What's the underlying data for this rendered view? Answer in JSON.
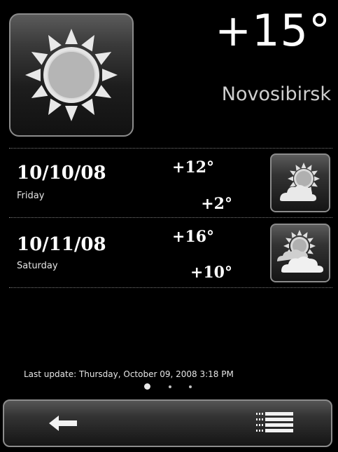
{
  "current": {
    "temperature": "+15°",
    "city": "Novosibirsk",
    "icon": "sun-icon"
  },
  "forecast": [
    {
      "date": "10/10/08",
      "day": "Friday",
      "high": "+12°",
      "low": "+2°",
      "icon": "partly-cloudy-icon"
    },
    {
      "date": "10/11/08",
      "day": "Saturday",
      "high": "+16°",
      "low": "+10°",
      "icon": "mostly-cloudy-icon"
    }
  ],
  "footer": {
    "last_update": "Last update: Thursday, October 09, 2008 3:18 PM",
    "pager": {
      "pages": 3,
      "active": 1
    }
  },
  "toolbar": {
    "back_icon": "back-arrow-icon",
    "menu_icon": "menu-list-icon"
  },
  "colors": {
    "background": "#000000",
    "tile_border": "#8c8c8c",
    "text": "#ffffff"
  }
}
